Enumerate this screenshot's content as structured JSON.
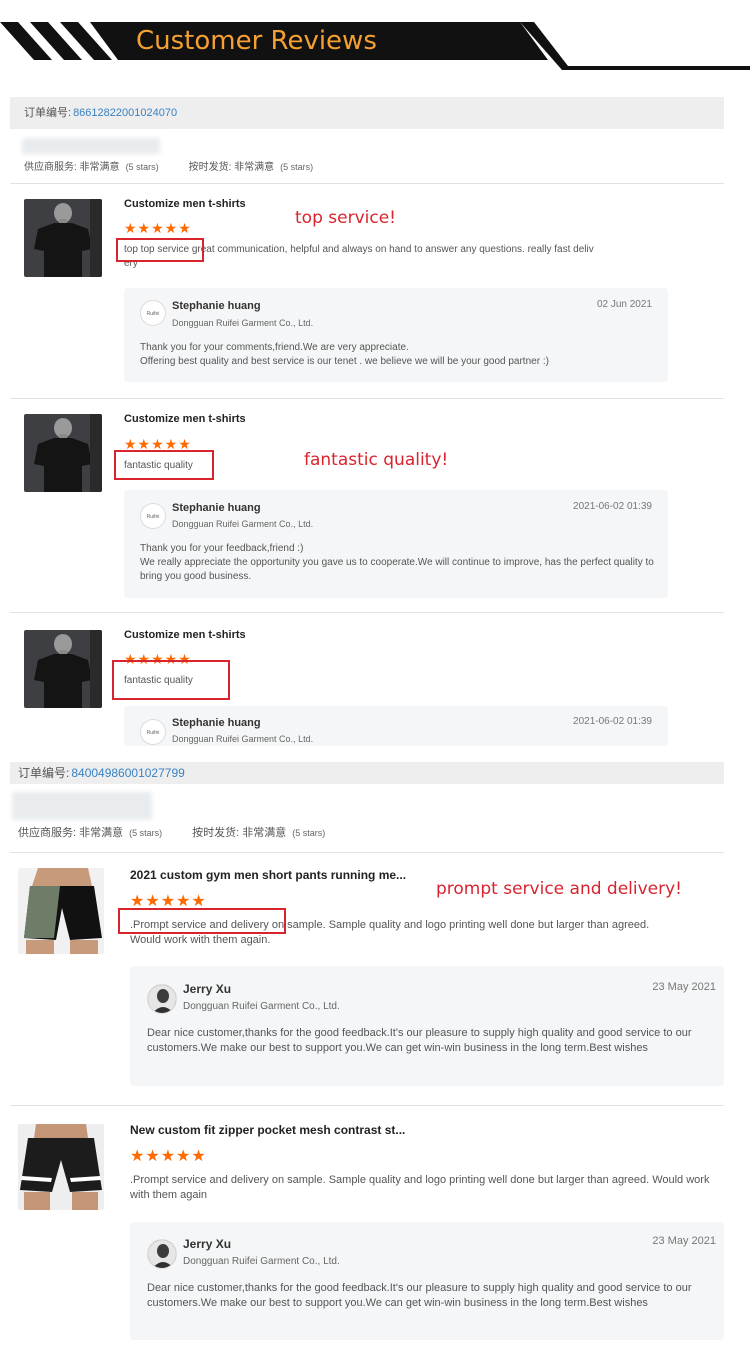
{
  "header": {
    "title": "Customer Reviews"
  },
  "colors": {
    "accent": "#f5a031",
    "star": "#ff6a00",
    "highlight": "#d9232d",
    "link": "#3a82c4"
  },
  "orders": [
    {
      "order_label": "订单编号:",
      "order_number": "86612822001024070",
      "supplier_service": "供应商服务: 非常满意",
      "supplier_stars": "(5 stars)",
      "on_time": "按时发货: 非常满意",
      "on_time_stars": "(5 stars)",
      "reviews": [
        {
          "title": "Customize men t-shirts",
          "stars": "★★★★★",
          "highlight": "top top service",
          "comment_rest": "great communication, helpful and always on hand to answer any questions. really fast deliv",
          "comment_wrap": "ery",
          "note": "top service!",
          "reply": {
            "logo": "Ruifei",
            "name": "Stephanie huang",
            "company": "Dongguan Ruifei Garment Co., Ltd.",
            "date": "02 Jun 2021",
            "text": "Thank you for your comments,friend.We are very appreciate.\nOffering best quality and best service is our tenet . we believe we will be your good partner :)"
          }
        },
        {
          "title": "Customize men t-shirts",
          "stars": "★★★★★",
          "highlight": "fantastic quality",
          "note": "fantastic quality!",
          "reply": {
            "logo": "Ruifei",
            "name": "Stephanie huang",
            "company": "Dongguan Ruifei Garment Co., Ltd.",
            "date": "2021-06-02 01:39",
            "text": "Thank you for your feedback,friend :)\nWe really appreciate the opportunity you gave us to cooperate.We will continue to improve, has the perfect quality to bring you good business."
          }
        },
        {
          "title": "Customize men t-shirts",
          "stars": "★★★★★",
          "highlight": "fantastic quality",
          "reply": {
            "logo": "Ruifei",
            "name": "Stephanie huang",
            "company": "Dongguan Ruifei Garment Co., Ltd.",
            "date": "2021-06-02 01:39"
          }
        }
      ]
    },
    {
      "order_label": "订单编号:",
      "order_number": "84004986001027799",
      "supplier_service": "供应商服务: 非常满意",
      "supplier_stars": "(5 stars)",
      "on_time": "按时发货: 非常满意",
      "on_time_stars": "(5 stars)",
      "reviews": [
        {
          "title": "2021 custom gym men short pants running me...",
          "stars": "★★★★★",
          "highlight": ".Prompt service and delivery",
          "comment_rest": "on sample. Sample quality and logo printing well done but larger than agreed.",
          "comment_wrap": "Would work with them again.",
          "note": "prompt service and delivery!",
          "reply": {
            "name": "Jerry Xu",
            "company": "Dongguan Ruifei Garment Co., Ltd.",
            "date": "23 May 2021",
            "text": "Dear nice customer,thanks for the good feedback.It's our pleasure to supply high quality and good service to our customers.We make our best to support you.We can get win-win business in the long term.Best wishes"
          }
        },
        {
          "title": "New custom fit zipper pocket mesh contrast st...",
          "stars": "★★★★★",
          "comment": ".Prompt service and delivery on sample. Sample quality and logo printing well done but larger than agreed. Would work with them again",
          "reply": {
            "name": "Jerry Xu",
            "company": "Dongguan Ruifei Garment Co., Ltd.",
            "date": "23 May 2021",
            "text": "Dear nice customer,thanks for the good feedback.It's our pleasure to supply high quality and good service to our customers.We make our best to support you.We can get win-win business in the long term.Best wishes"
          }
        }
      ]
    }
  ]
}
